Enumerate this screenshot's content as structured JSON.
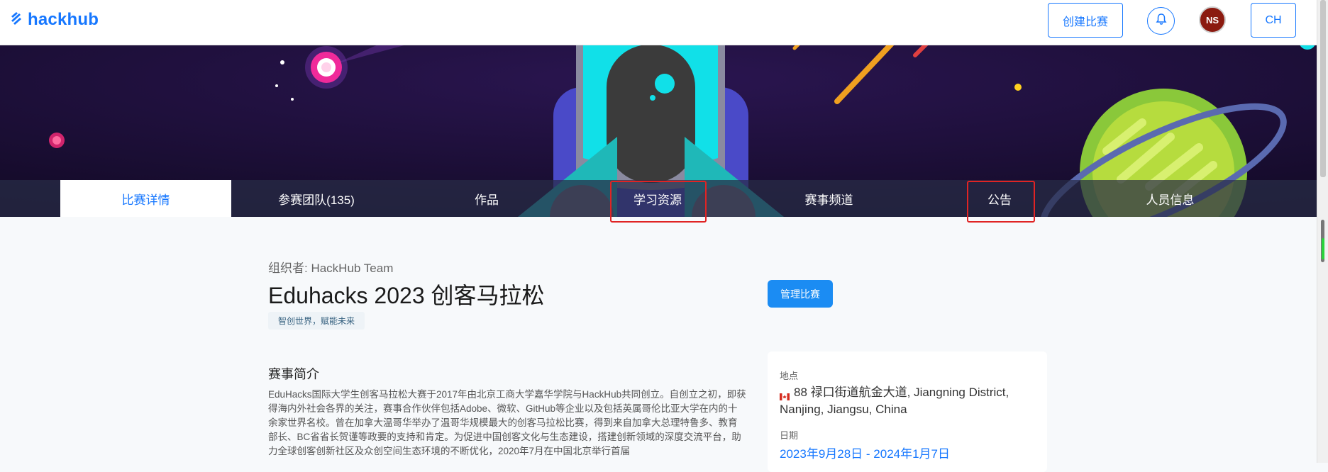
{
  "header": {
    "logo_text": "hackhub",
    "create_button": "创建比赛",
    "avatar_initials": "NS",
    "lang_button": "CH",
    "accent_color": "#1677ff"
  },
  "tabs": [
    {
      "label": "比赛详情"
    },
    {
      "label": "参赛团队(135)"
    },
    {
      "label": "作品"
    },
    {
      "label": "学习资源"
    },
    {
      "label": "赛事频道"
    },
    {
      "label": "公告"
    },
    {
      "label": "人员信息"
    }
  ],
  "main": {
    "organizer": "组织者: HackHub Team",
    "title": "Eduhacks 2023 创客马拉松",
    "tag": "智创世界，赋能未来",
    "manage_button": "管理比赛",
    "intro_heading": "赛事简介",
    "intro_text": "EduHacks国际大学生创客马拉松大赛于2017年由北京工商大学嘉华学院与HackHub共同创立。自创立之初，即获得海内外社会各界的关注，赛事合作伙伴包括Adobe、微软、GitHub等企业以及包括英属哥伦比亚大学在内的十余家世界名校。曾在加拿大温哥华举办了温哥华规模最大的创客马拉松比赛，得到来自加拿大总理特鲁多、教育部长、BC省省长贺谨等政要的支持和肯定。为促进中国创客文化与生态建设，搭建创新领域的深度交流平台，助力全球创客创新社区及众创空间生态环境的不断优化，2020年7月在中国北京举行首届"
  },
  "info": {
    "location_label": "地点",
    "location_value": "88 禄口街道航金大道, Jiangning District, Nanjing, Jiangsu, China",
    "date_label": "日期",
    "date_value": "2023年9月28日 - 2024年1月7日"
  }
}
